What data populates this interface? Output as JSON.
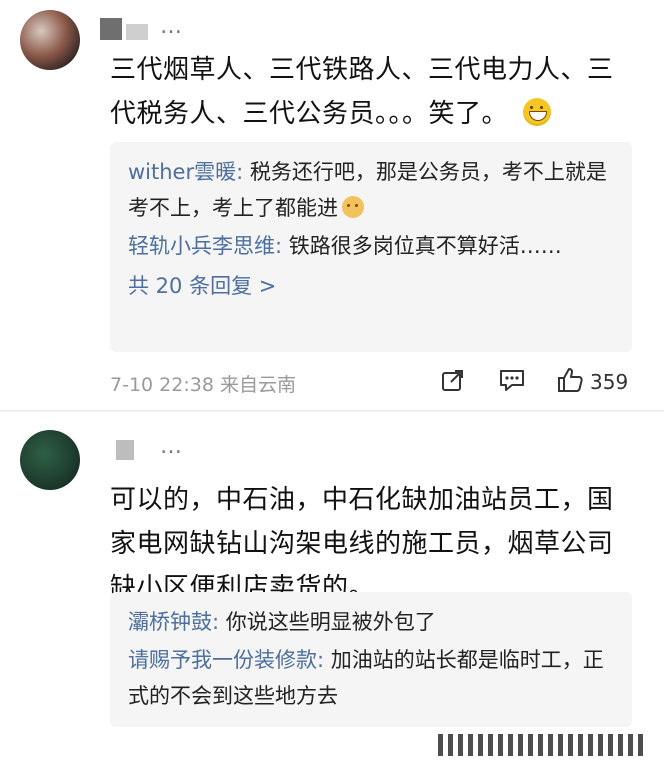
{
  "comment1": {
    "username": "…",
    "content_line1": "三代烟草人、三代铁路人、三代电力人、三",
    "content_line2": "代税务人、三代公务员。。。笑了。",
    "emoji": "grin-emoji",
    "replies": [
      {
        "name": "wither雲暖:",
        "text": " 税务还行吧，那是公务员，考不上就是考不上，考上了都能进"
      },
      {
        "name": "轻轨小兵李思维:",
        "text": " 铁路很多岗位真不算好活……"
      }
    ],
    "more_replies": "共 20 条回复 >",
    "timestamp": "7-10 22:38  来自云南",
    "likes": "359"
  },
  "comment2": {
    "username": "…",
    "content_line1": "可以的，中石油，中石化缺加油站员工，国",
    "content_line2": "家电网缺钻山沟架电线的施工员，烟草公司",
    "content_line3": "缺小区便利店卖货的。",
    "replies": [
      {
        "name": "灞桥钟鼓:",
        "text": " 你说这些明显被外包了"
      },
      {
        "name": "请赐予我一份装修款:",
        "text": " 加油站的站长都是临时工，正式的不会到这些地方去"
      }
    ]
  },
  "colors": {
    "accent_link": "#4c6f9e",
    "reply_bg": "#f5f5f5",
    "meta_gray": "#9a9a9a"
  }
}
